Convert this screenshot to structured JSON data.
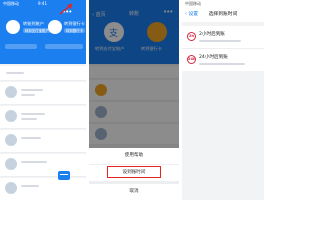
{
  "screen1": {
    "status_left": "中国移动",
    "status_time": "9:41",
    "tiles": [
      {
        "label": "转账到账户",
        "sub": "转到支付宝账户"
      },
      {
        "label": "转到银行卡",
        "sub": "转到银行卡"
      }
    ],
    "more_icon": "more-dots-icon",
    "fab_icon": "card-icon"
  },
  "screen2": {
    "back_label": "首页",
    "title": "转账",
    "tiles": [
      {
        "label": "转到支付宝账户"
      },
      {
        "label": "转到银行卡"
      }
    ],
    "sheet": {
      "items": [
        "使用帮助",
        "设到账时间",
        "取消"
      ],
      "highlighted_index": 1
    },
    "icon_colors": {
      "blue": "#1b7ff0",
      "orange": "#f5a623"
    }
  },
  "screen3": {
    "back_label": "设置",
    "title": "选择到账时间",
    "options": [
      {
        "icon_text": "2h",
        "title": "2小时后到账"
      },
      {
        "icon_text": "24h",
        "title": "24小时后到账"
      }
    ],
    "accent_color": "#d7263d"
  },
  "colors": {
    "brand_blue": "#1b7ff0",
    "highlight_red": "#e8231a"
  }
}
